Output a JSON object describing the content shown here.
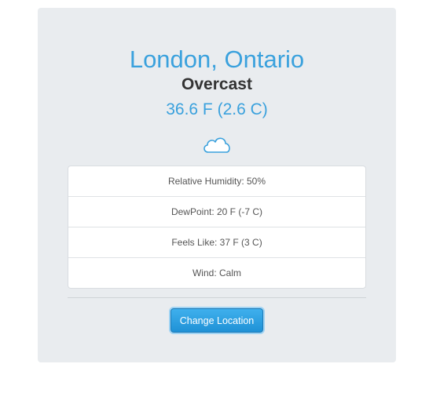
{
  "location": {
    "title": "London, Ontario"
  },
  "weather": {
    "condition": "Overcast",
    "temperature": "36.6 F (2.6 C)",
    "icon": "cloud-icon"
  },
  "details": {
    "humidity": "Relative Humidity: 50%",
    "dewpoint": "DewPoint: 20 F (-7 C)",
    "feels_like": "Feels Like: 37 F (3 C)",
    "wind": "Wind: Calm"
  },
  "actions": {
    "change_location_label": "Change Location"
  },
  "colors": {
    "accent": "#3aa1dd",
    "card_background": "#e9ecef",
    "button": "#2a9fe3"
  }
}
